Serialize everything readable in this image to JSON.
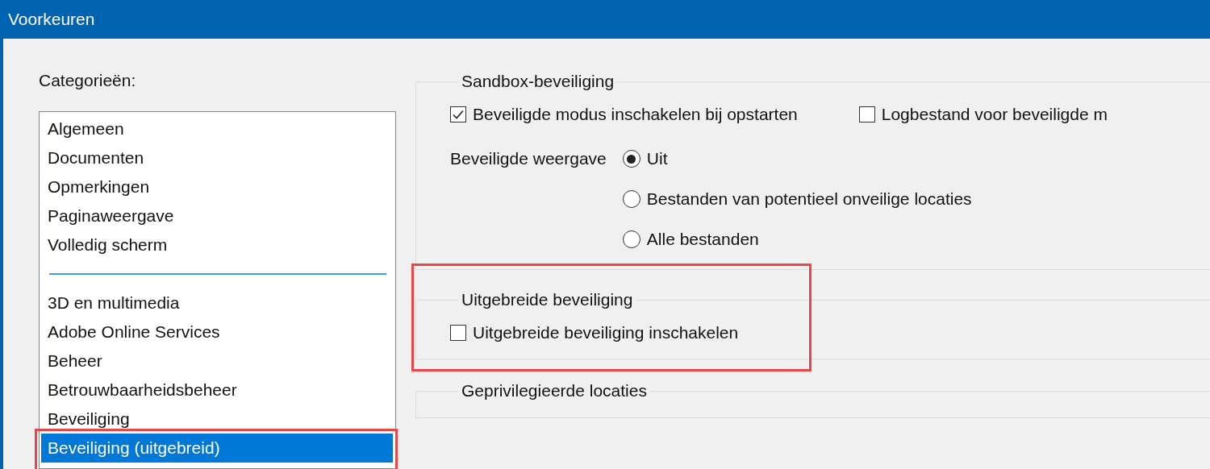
{
  "window": {
    "title": "Voorkeuren"
  },
  "categories": {
    "label": "Categorieën:",
    "items": [
      {
        "kind": "item",
        "label": "Algemeen",
        "selected": false,
        "highlighted": false
      },
      {
        "kind": "item",
        "label": "Documenten",
        "selected": false,
        "highlighted": false
      },
      {
        "kind": "item",
        "label": "Opmerkingen",
        "selected": false,
        "highlighted": false
      },
      {
        "kind": "item",
        "label": "Paginaweergave",
        "selected": false,
        "highlighted": false
      },
      {
        "kind": "item",
        "label": "Volledig scherm",
        "selected": false,
        "highlighted": false
      },
      {
        "kind": "separator"
      },
      {
        "kind": "item",
        "label": "3D en multimedia",
        "selected": false,
        "highlighted": false
      },
      {
        "kind": "item",
        "label": "Adobe Online Services",
        "selected": false,
        "highlighted": false
      },
      {
        "kind": "item",
        "label": "Beheer",
        "selected": false,
        "highlighted": false
      },
      {
        "kind": "item",
        "label": "Betrouwbaarheidsbeheer",
        "selected": false,
        "highlighted": false
      },
      {
        "kind": "item",
        "label": "Beveiliging",
        "selected": false,
        "highlighted": false
      },
      {
        "kind": "item",
        "label": "Beveiliging (uitgebreid)",
        "selected": true,
        "highlighted": true
      }
    ]
  },
  "groups": [
    {
      "title": "Sandbox-beveiliging",
      "highlighted": false,
      "controls": [
        {
          "kind": "checkbox-row",
          "items": [
            {
              "label": "Beveiligde modus inschakelen bij opstarten",
              "checked": true
            },
            {
              "label": "Logbestand voor beveiligde m",
              "checked": false
            }
          ]
        },
        {
          "kind": "radio-group",
          "label": "Beveiligde weergave",
          "options": [
            {
              "label": "Uit",
              "selected": true
            },
            {
              "label": "Bestanden van potentieel onveilige locaties",
              "selected": false
            },
            {
              "label": "Alle bestanden",
              "selected": false
            }
          ]
        }
      ]
    },
    {
      "title": "Uitgebreide beveiliging",
      "highlighted": true,
      "controls": [
        {
          "kind": "checkbox-row",
          "items": [
            {
              "label": "Uitgebreide beveiliging inschakelen",
              "checked": false
            }
          ]
        }
      ]
    },
    {
      "title": "Geprivilegieerde locaties",
      "highlighted": false
    }
  ]
}
